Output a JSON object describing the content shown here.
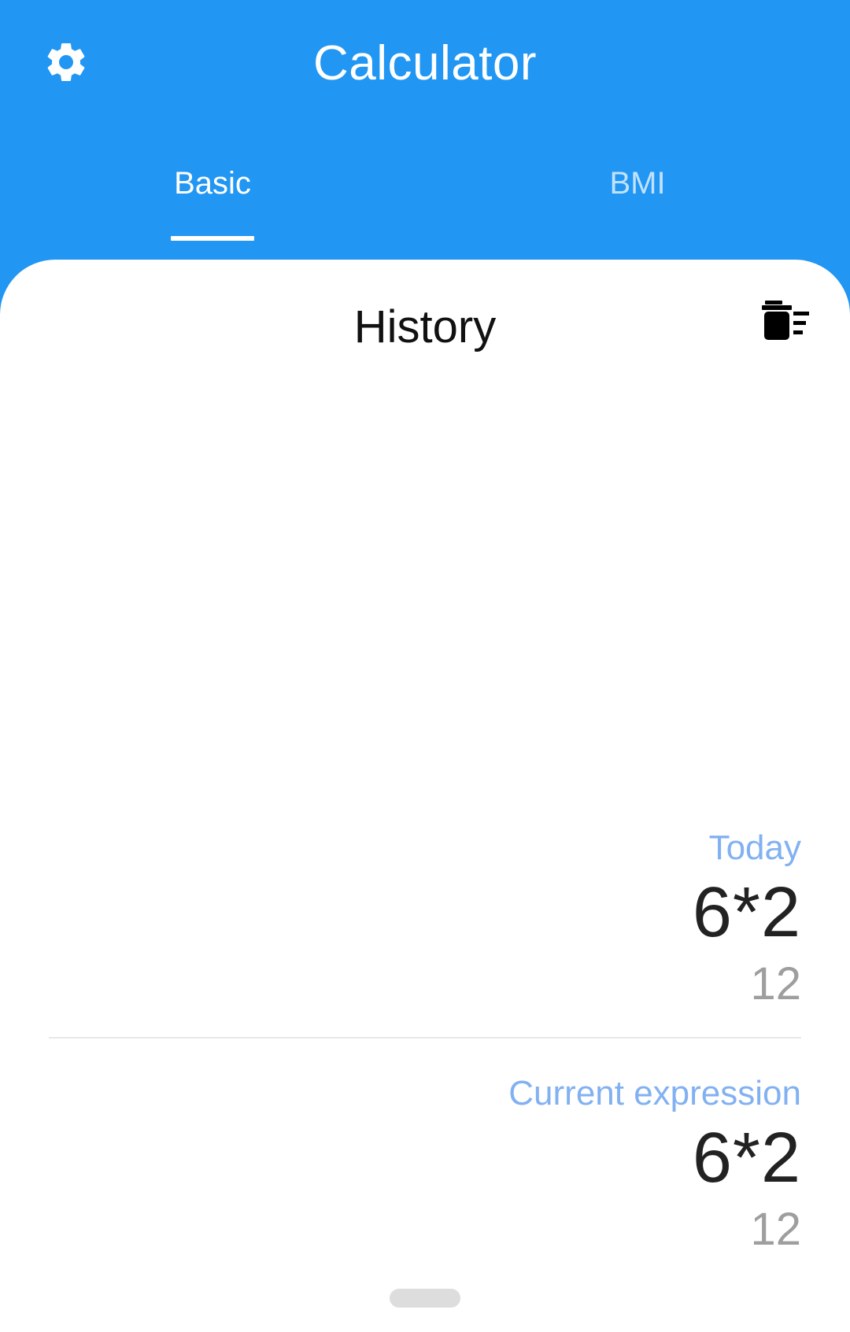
{
  "app_bar": {
    "title": "Calculator",
    "settings_icon": "gear-icon",
    "background_color": "#2196F3"
  },
  "tabs": [
    {
      "label": "Basic",
      "active": true
    },
    {
      "label": "BMI",
      "active": false
    }
  ],
  "history": {
    "title": "History",
    "clear_icon": "delete-sweep-icon",
    "sections": [
      {
        "header": "Today",
        "expression": "6*2",
        "result": "12"
      },
      {
        "header": "Current expression",
        "expression": "6*2",
        "result": "12"
      }
    ],
    "header_color": "#82B1F2"
  }
}
